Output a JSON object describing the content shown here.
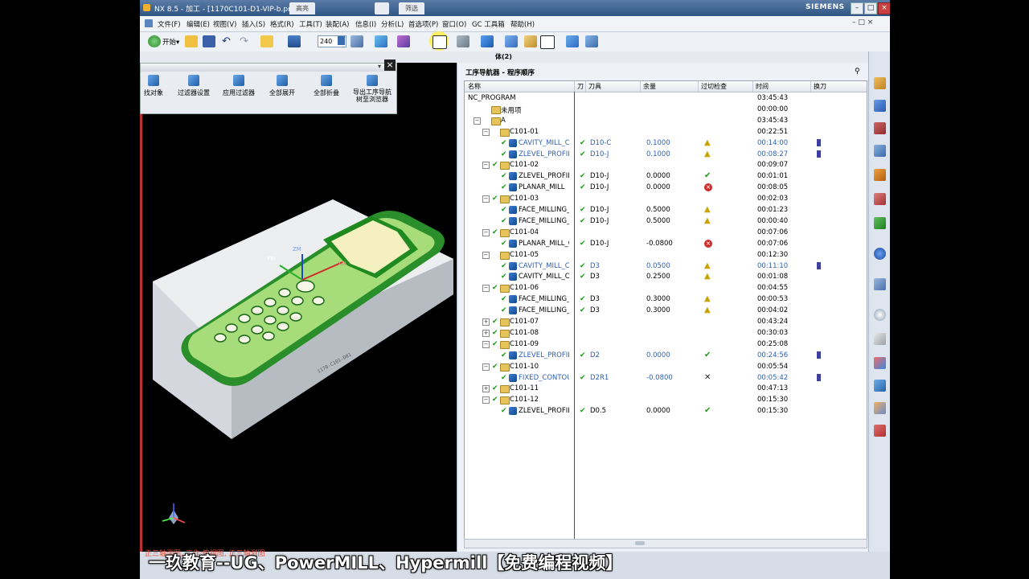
{
  "window": {
    "title": "NX 8.5 - 加工 - [1170C101-D1-VIP-b.prt",
    "tabs": [
      "高亮",
      "筛选"
    ],
    "brand": "SIEMENS"
  },
  "menu": [
    "文件(F)",
    "编辑(E)",
    "视图(V)",
    "插入(S)",
    "格式(R)",
    "工具(T)",
    "装配(A)",
    "信息(I)",
    "分析(L)",
    "首选项(P)",
    "窗口(O)",
    "GC 工具箱",
    "帮助(H)"
  ],
  "toolbar": {
    "start_label": "开始▾",
    "zoom_value": "240"
  },
  "subbar": {
    "label": "体(2)"
  },
  "filter_panel": {
    "buttons": [
      "找对象",
      "过滤器设置",
      "应用过滤器",
      "全部展开",
      "全部折叠",
      "导出工序导航\n树至浏览器"
    ]
  },
  "navigator": {
    "title": "工序导航器 - 程序顺序",
    "columns": [
      "名称",
      "刀",
      "刀具",
      "余量",
      "过切检查",
      "时间",
      "换刀"
    ],
    "rows": [
      {
        "level": 0,
        "exp": "",
        "chk": false,
        "icon": "none",
        "name": "NC_PROGRAM",
        "tool": "",
        "stock": "",
        "gouge": "",
        "time": "03:45:43",
        "tc": false,
        "blue": false
      },
      {
        "level": 1,
        "exp": "",
        "chk": false,
        "icon": "folder",
        "name": "未用项",
        "tool": "",
        "stock": "",
        "gouge": "",
        "time": "00:00:00",
        "tc": false,
        "blue": false
      },
      {
        "level": 1,
        "exp": "−",
        "chk": false,
        "icon": "folder",
        "name": "A",
        "tool": "",
        "stock": "",
        "gouge": "",
        "time": "03:45:43",
        "tc": false,
        "blue": false
      },
      {
        "level": 2,
        "exp": "−",
        "chk": false,
        "icon": "folder",
        "name": "C101-01",
        "tool": "",
        "stock": "",
        "gouge": "",
        "time": "00:22:51",
        "tc": false,
        "blue": false
      },
      {
        "level": 3,
        "exp": "",
        "chk": true,
        "icon": "op",
        "name": "CAVITY_MILL_C...",
        "tool": "D10-C",
        "stock": "0.1000",
        "gouge": "warn",
        "time": "00:14:00",
        "tc": true,
        "blue": true
      },
      {
        "level": 3,
        "exp": "",
        "chk": true,
        "icon": "op",
        "name": "ZLEVEL_PROFILE...",
        "tool": "D10-J",
        "stock": "0.1000",
        "gouge": "warn",
        "time": "00:08:27",
        "tc": true,
        "blue": true
      },
      {
        "level": 2,
        "exp": "−",
        "chk": true,
        "icon": "folder",
        "name": "C101-02",
        "tool": "",
        "stock": "",
        "gouge": "",
        "time": "00:09:07",
        "tc": false,
        "blue": false
      },
      {
        "level": 3,
        "exp": "",
        "chk": true,
        "icon": "op",
        "name": "ZLEVEL_PROFILE...",
        "tool": "D10-J",
        "stock": "0.0000",
        "gouge": "ok",
        "time": "00:01:01",
        "tc": false,
        "blue": false
      },
      {
        "level": 3,
        "exp": "",
        "chk": true,
        "icon": "op",
        "name": "PLANAR_MILL",
        "tool": "D10-J",
        "stock": "0.0000",
        "gouge": "err",
        "time": "00:08:05",
        "tc": false,
        "blue": false
      },
      {
        "level": 2,
        "exp": "−",
        "chk": true,
        "icon": "folder",
        "name": "C101-03",
        "tool": "",
        "stock": "",
        "gouge": "",
        "time": "00:02:03",
        "tc": false,
        "blue": false
      },
      {
        "level": 3,
        "exp": "",
        "chk": true,
        "icon": "op",
        "name": "FACE_MILLING_...",
        "tool": "D10-J",
        "stock": "0.5000",
        "gouge": "warn",
        "time": "00:01:23",
        "tc": false,
        "blue": false
      },
      {
        "level": 3,
        "exp": "",
        "chk": true,
        "icon": "op",
        "name": "FACE_MILLING_...",
        "tool": "D10-J",
        "stock": "0.5000",
        "gouge": "warn",
        "time": "00:00:40",
        "tc": false,
        "blue": false
      },
      {
        "level": 2,
        "exp": "−",
        "chk": true,
        "icon": "folder",
        "name": "C101-04",
        "tool": "",
        "stock": "",
        "gouge": "",
        "time": "00:07:06",
        "tc": false,
        "blue": false
      },
      {
        "level": 3,
        "exp": "",
        "chk": true,
        "icon": "op",
        "name": "PLANAR_MILL_C...",
        "tool": "D10-J",
        "stock": "-0.0800",
        "gouge": "err",
        "time": "00:07:06",
        "tc": false,
        "blue": false
      },
      {
        "level": 2,
        "exp": "−",
        "chk": false,
        "icon": "folder",
        "name": "C101-05",
        "tool": "",
        "stock": "",
        "gouge": "",
        "time": "00:12:30",
        "tc": false,
        "blue": false
      },
      {
        "level": 3,
        "exp": "",
        "chk": true,
        "icon": "op",
        "name": "CAVITY_MILL_C...",
        "tool": "D3",
        "stock": "0.0500",
        "gouge": "warn",
        "time": "00:11:10",
        "tc": true,
        "blue": true
      },
      {
        "level": 3,
        "exp": "",
        "chk": true,
        "icon": "op",
        "name": "CAVITY_MILL_C...",
        "tool": "D3",
        "stock": "0.2500",
        "gouge": "warn",
        "time": "00:01:08",
        "tc": false,
        "blue": false
      },
      {
        "level": 2,
        "exp": "−",
        "chk": true,
        "icon": "folder",
        "name": "C101-06",
        "tool": "",
        "stock": "",
        "gouge": "",
        "time": "00:04:55",
        "tc": false,
        "blue": false
      },
      {
        "level": 3,
        "exp": "",
        "chk": true,
        "icon": "op",
        "name": "FACE_MILLING_...",
        "tool": "D3",
        "stock": "0.3000",
        "gouge": "warn",
        "time": "00:00:53",
        "tc": false,
        "blue": false
      },
      {
        "level": 3,
        "exp": "",
        "chk": true,
        "icon": "op",
        "name": "FACE_MILLING_...",
        "tool": "D3",
        "stock": "0.3000",
        "gouge": "warn",
        "time": "00:04:02",
        "tc": false,
        "blue": false
      },
      {
        "level": 2,
        "exp": "+",
        "chk": true,
        "icon": "folder",
        "name": "C101-07",
        "tool": "",
        "stock": "",
        "gouge": "",
        "time": "00:43:24",
        "tc": false,
        "blue": false
      },
      {
        "level": 2,
        "exp": "+",
        "chk": true,
        "icon": "folder",
        "name": "C101-08",
        "tool": "",
        "stock": "",
        "gouge": "",
        "time": "00:30:03",
        "tc": false,
        "blue": false
      },
      {
        "level": 2,
        "exp": "−",
        "chk": true,
        "icon": "folder",
        "name": "C101-09",
        "tool": "",
        "stock": "",
        "gouge": "",
        "time": "00:25:08",
        "tc": false,
        "blue": false
      },
      {
        "level": 3,
        "exp": "",
        "chk": true,
        "icon": "op",
        "name": "ZLEVEL_PROFILE...",
        "tool": "D2",
        "stock": "0.0000",
        "gouge": "ok",
        "time": "00:24:56",
        "tc": true,
        "blue": true
      },
      {
        "level": 2,
        "exp": "−",
        "chk": true,
        "icon": "folder",
        "name": "C101-10",
        "tool": "",
        "stock": "",
        "gouge": "",
        "time": "00:05:54",
        "tc": false,
        "blue": false
      },
      {
        "level": 3,
        "exp": "",
        "chk": true,
        "icon": "op",
        "name": "FIXED_CONTOU...",
        "tool": "D2R1",
        "stock": "-0.0800",
        "gouge": "x",
        "time": "00:05:42",
        "tc": true,
        "blue": true
      },
      {
        "level": 2,
        "exp": "+",
        "chk": true,
        "icon": "folder",
        "name": "C101-11",
        "tool": "",
        "stock": "",
        "gouge": "",
        "time": "00:47:13",
        "tc": false,
        "blue": false
      },
      {
        "level": 2,
        "exp": "−",
        "chk": true,
        "icon": "folder",
        "name": "C101-12",
        "tool": "",
        "stock": "",
        "gouge": "",
        "time": "00:15:30",
        "tc": false,
        "blue": false
      },
      {
        "level": 3,
        "exp": "",
        "chk": true,
        "icon": "op",
        "name": "ZLEVEL_PROFILE...",
        "tool": "D0.5",
        "stock": "0.0000",
        "gouge": "ok",
        "time": "00:15:30",
        "tc": false,
        "blue": false
      }
    ]
  },
  "graphics": {
    "axis_labels": [
      "ZM",
      "YM",
      "XM"
    ],
    "part_engraving": "1170-C101-D01"
  },
  "view_label": "正三轴测图, 工作:俯视图, 正三轴测图",
  "watermark": "一玖教育--UG、PowerMILL、Hypermill【免费编程视频】"
}
